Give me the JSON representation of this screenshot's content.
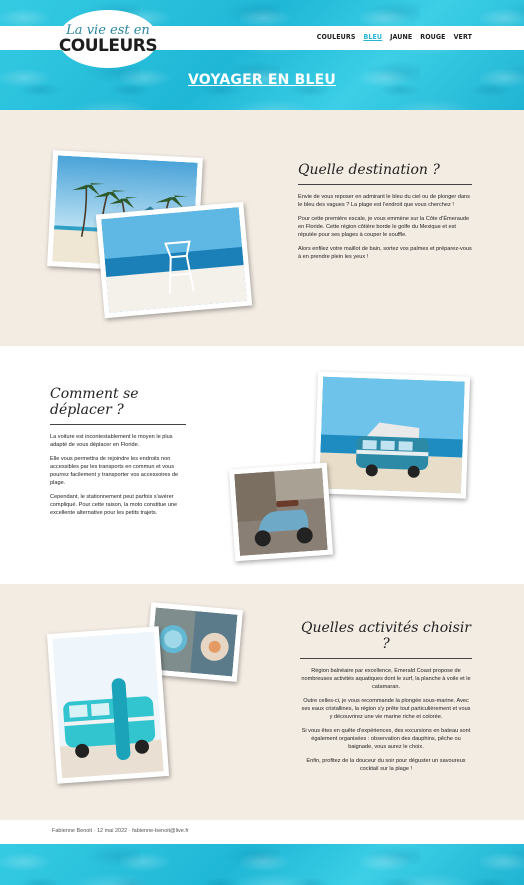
{
  "logo": {
    "script": "La vie est en",
    "main": "COULEURS"
  },
  "nav": {
    "items": [
      "COULEURS",
      "BLEU",
      "JAUNE",
      "ROUGE",
      "VERT"
    ],
    "active": "BLEU"
  },
  "page_title": "VOYAGER EN BLEU",
  "section1": {
    "heading": "Quelle destination ?",
    "paragraphs": [
      "Envie de vous reposer en admirant le bleu du ciel ou de plonger dans le bleu des vagues ? La plage est l'endroit que vous cherchez !",
      "Pour cette première escale, je vous emmène sur la Côte d'Émeraude en Floride. Cette région côtière borde le golfe du Mexique et est réputée pour ses plages à couper le souffle.",
      "Alors enfilez votre maillot de bain, sortez vos palmes et préparez-vous à en prendre plein les yeux !"
    ]
  },
  "section2": {
    "heading": "Comment se déplacer ?",
    "paragraphs": [
      "La voiture est incontestablement le moyen le plus adapté de vous déplacer en Floride.",
      "Elle vous permettra de rejoindre les endroits non accessibles par les transports en commun et vous pourrez facilement y transporter vos accessoires de plage.",
      "Cependant, le stationnement peut parfois s'avérer compliqué. Pour cette raison, la moto constitue une excellente alternative pour les petits trajets."
    ]
  },
  "section3": {
    "heading": "Quelles activités choisir ?",
    "paragraphs": [
      "Région balnéaire par excellence, Emerald Coast propose de nombreuses activités aquatiques dont le surf, la planche à voile et le catamaran.",
      "Outre celles-ci, je vous recommande la plongée sous-marine. Avec ses eaux cristallines, la région s'y prête tout particulièrement et vous y découvrirez une vie marine riche et colorée.",
      "Si vous êtes en quête d'expériences, des excursions en bateau sont également organisées : observation des dauphins, pêche ou baignade, vous aurez le choix.",
      "Enfin, profitez de la douceur du soir pour déguster un savoureux cocktail sur la plage !"
    ]
  },
  "footer": {
    "text": "Fabienne Benoit · 12 mai 2022 · fabienne-benoit@live.fr"
  },
  "colors": {
    "accent": "#27b6d4",
    "sand": "#f3ece3",
    "water": "#27c3de"
  }
}
